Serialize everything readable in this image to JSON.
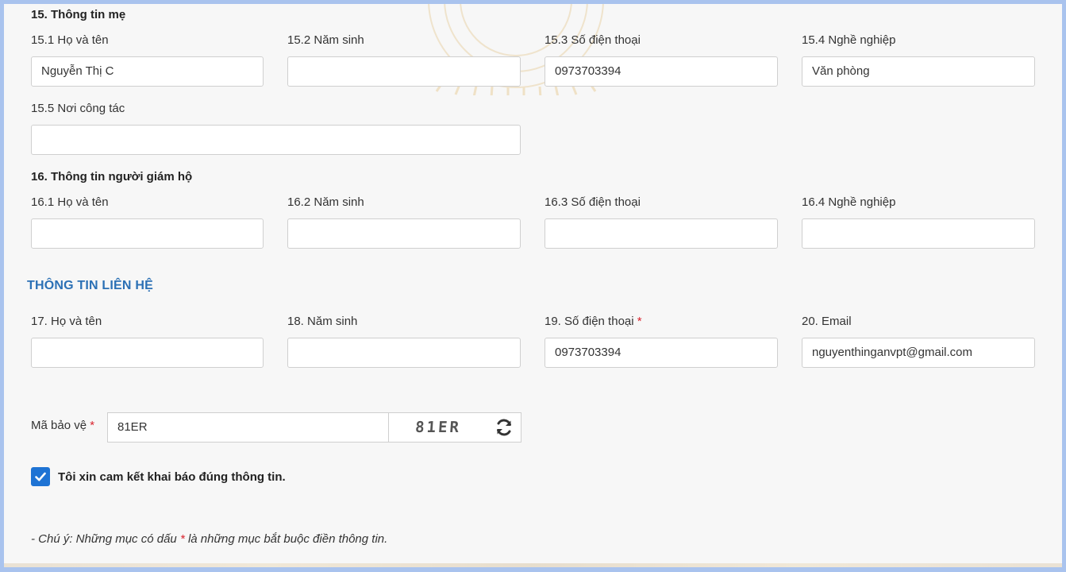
{
  "mother": {
    "title": "15. Thông tin mẹ",
    "name_label": "15.1 Họ và tên",
    "name_value": "Nguyễn Thị C",
    "birth_label": "15.2 Năm sinh",
    "birth_value": "",
    "phone_label": "15.3 Số điện thoại",
    "phone_value": "0973703394",
    "job_label": "15.4 Nghề nghiệp",
    "job_value": "Văn phòng",
    "workplace_label": "15.5 Nơi công tác",
    "workplace_value": ""
  },
  "guardian": {
    "title": "16. Thông tin người giám hộ",
    "name_label": "16.1 Họ và tên",
    "name_value": "",
    "birth_label": "16.2 Năm sinh",
    "birth_value": "",
    "phone_label": "16.3 Số điện thoại",
    "phone_value": "",
    "job_label": "16.4 Nghề nghiệp",
    "job_value": ""
  },
  "contact": {
    "heading": "THÔNG TIN LIÊN HỆ",
    "name_label": "17. Họ và tên",
    "name_value": "",
    "birth_label": "18. Năm sinh",
    "birth_value": "",
    "phone_label": "19. Số điện thoại",
    "phone_required": "*",
    "phone_value": "0973703394",
    "email_label": "20. Email",
    "email_value": "nguyenthinganvpt@gmail.com"
  },
  "captcha": {
    "label": "Mã bảo vệ",
    "required": "*",
    "value": "81ER",
    "image_text": "81ER",
    "refresh_icon": "refresh-icon"
  },
  "commitment": {
    "checked": true,
    "label": "Tôi xin cam kết khai báo đúng thông tin."
  },
  "note": {
    "prefix": "- Chú ý: Những mục có dấu",
    "star": "*",
    "suffix": "là những mục bắt buộc điền thông tin."
  },
  "colors": {
    "frame": "#a9c3ee",
    "heading_blue": "#2b70b5",
    "required_red": "#d9232d",
    "checkbox_blue": "#1e73d4"
  }
}
